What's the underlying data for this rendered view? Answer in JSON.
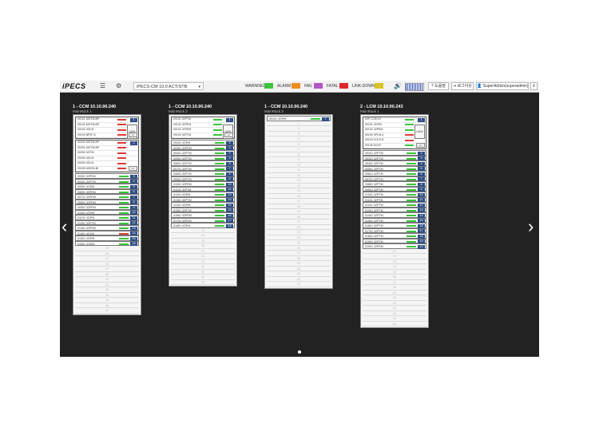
{
  "header": {
    "logo": "iPECS",
    "menu_icon": "hamburger-icon",
    "settings_icon": "gear-icon",
    "system_select": "iPECS-CM 10.0 ACT/STB",
    "legend": [
      {
        "label": "WARNING",
        "color": "#3cc43c"
      },
      {
        "label": "ALARM",
        "color": "#f08c1e"
      },
      {
        "label": "FAIL",
        "color": "#b356c9"
      },
      {
        "label": "FATAL",
        "color": "#e0282a"
      },
      {
        "label": "LINK-DOWN",
        "color": "#d8c227"
      }
    ],
    "sound_icon": "speaker-icon",
    "help_label": "? 도움말",
    "logout_label": "⇥ 로그아웃",
    "user_label": "👤 SuperAdmin(superadmin)",
    "user_caret": "⇕"
  },
  "racks": [
    {
      "title": "1 - CCM 10.10.90.240",
      "subtitle": "MainRack 1",
      "main_groups": [
        {
          "ports": [
            {
              "name": "00101 MGTM-BP",
              "state": "red"
            },
            {
              "name": "00101 MGTM-BP",
              "state": "red"
            },
            {
              "name": "00102 4GLM",
              "state": "red"
            },
            {
              "name": "00103 BP2F-6",
              "state": "red"
            }
          ],
          "badge": "1",
          "tag": "LAN1"
        },
        {
          "ports": [
            {
              "name": "00201 MGTM-BP",
              "state": "red"
            },
            {
              "name": "00201 MGTM-BP",
              "state": "red"
            },
            {
              "name": "00202 4GTM",
              "state": "red"
            },
            {
              "name": "00203 4GLM",
              "state": "red"
            },
            {
              "name": "00204 4GLM",
              "state": "red"
            },
            {
              "name": "00205 MGEM-BI",
              "state": "red"
            }
          ],
          "badge": "2",
          "tag": ""
        }
      ],
      "cards": [
        {
          "name": "00301 32PEM",
          "state": "green",
          "no": "3"
        },
        {
          "name": "00401 32PTM",
          "state": "green",
          "no": "4"
        },
        {
          "name": "00501 4GDM",
          "state": "green",
          "no": "5"
        },
        {
          "name": "00601 32PEM",
          "state": "green",
          "no": "6"
        },
        {
          "name": "00701 32PEM",
          "state": "green",
          "no": "7"
        },
        {
          "name": "00801 32PEM",
          "state": "green",
          "no": "8"
        },
        {
          "name": "00901 32PEM",
          "state": "green",
          "no": "9"
        },
        {
          "name": "01001 VDPM",
          "state": "green",
          "no": "10"
        },
        {
          "name": "01101 VDPM",
          "state": "green",
          "no": "11"
        },
        {
          "name": "01201 32PTM",
          "state": "green",
          "no": "12"
        },
        {
          "name": "01301 32PEM",
          "state": "green",
          "no": "13"
        },
        {
          "name": "01401 4GLM",
          "state": "red",
          "no": "14"
        },
        {
          "name": "01501 VDPM",
          "state": "green",
          "no": "15"
        },
        {
          "name": "01601 4GDM",
          "state": "green",
          "no": "16"
        }
      ],
      "empty_slots": [
        "25",
        "26",
        "27",
        "28",
        "29",
        "30",
        "31",
        "32",
        "33",
        "34",
        "35",
        "36",
        "37"
      ]
    },
    {
      "title": "1 - CCM 10.10.90.240",
      "subtitle": "MainRack 2",
      "main_groups": [
        {
          "ports": [
            {
              "name": "00101 32PTM",
              "state": "green"
            },
            {
              "name": "00102 32PEM",
              "state": "green"
            },
            {
              "name": "00103 32PEM",
              "state": "green"
            },
            {
              "name": "00104 32PTM",
              "state": "green"
            }
          ],
          "badge": "1",
          "tag": "LAN1"
        }
      ],
      "cards": [
        {
          "name": "00201 VDPM",
          "state": "green",
          "no": "2"
        },
        {
          "name": "00301 32PEM",
          "state": "green",
          "no": "3"
        },
        {
          "name": "00401 32PTM",
          "state": "green",
          "no": "4"
        },
        {
          "name": "00501 32PTM",
          "state": "green",
          "no": "5"
        },
        {
          "name": "00601 32PTM",
          "state": "green",
          "no": "6"
        },
        {
          "name": "00701 32PTM",
          "state": "green",
          "no": "7"
        },
        {
          "name": "00801 32PTM",
          "state": "green",
          "no": "8"
        },
        {
          "name": "00901 32PTM",
          "state": "green",
          "no": "9"
        },
        {
          "name": "01001 32PEM",
          "state": "green",
          "no": "10"
        },
        {
          "name": "01101 32PTM",
          "state": "green",
          "no": "11"
        },
        {
          "name": "01201 VDPM",
          "state": "green",
          "no": "12"
        },
        {
          "name": "01301 32PTM",
          "state": "green",
          "no": "13"
        },
        {
          "name": "01401 VDPM",
          "state": "green",
          "no": "14"
        },
        {
          "name": "01501 32PTM",
          "state": "green",
          "no": "15"
        },
        {
          "name": "01601 32PEM",
          "state": "green",
          "no": "16"
        },
        {
          "name": "01701 32PEM",
          "state": "green",
          "no": "17"
        },
        {
          "name": "01801 VDPM",
          "state": "green",
          "no": "18"
        }
      ],
      "empty_slots": [
        "23",
        "24",
        "25",
        "26",
        "27",
        "28",
        "29",
        "30",
        "31",
        "32",
        "33"
      ]
    },
    {
      "title": "1 - CCM 10.10.90.240",
      "subtitle": "MainRack 3",
      "main_groups": [],
      "cards": [
        {
          "name": "00101 VDPM",
          "state": "green",
          "no": "1"
        }
      ],
      "empty_slots": [
        "2",
        "3",
        "4",
        "5",
        "6",
        "7",
        "8",
        "9",
        "10",
        "11",
        "12",
        "13",
        "14",
        "15",
        "16",
        "17",
        "18",
        "19",
        "20",
        "21",
        "22",
        "23",
        "24",
        "25",
        "26",
        "27",
        "28",
        "29",
        "30",
        "31",
        "32",
        "33"
      ]
    },
    {
      "title": "2 - LCM 10.10.90.243",
      "subtitle": "MainRack 1",
      "main_groups": [
        {
          "ports": [
            {
              "name": "00P LCM 5.0",
              "state": "green"
            },
            {
              "name": "00101 VDPM",
              "state": "green"
            },
            {
              "name": "00102 32PEM",
              "state": "green"
            },
            {
              "name": "00103 VPLM-4",
              "state": "red"
            },
            {
              "name": "00104 VOLP-8",
              "state": "red"
            },
            {
              "name": "00105 DOLP",
              "state": "green"
            }
          ],
          "badge": "1",
          "tag": "LAN1"
        }
      ],
      "cards": [
        {
          "name": "00201 32PTM",
          "state": "green",
          "no": "2"
        },
        {
          "name": "00301 32PTM",
          "state": "green",
          "no": "3"
        },
        {
          "name": "00401 32PTM",
          "state": "green",
          "no": "4"
        },
        {
          "name": "00501 32PTM",
          "state": "green",
          "no": "5"
        },
        {
          "name": "00601 32PTM",
          "state": "green",
          "no": "6"
        },
        {
          "name": "00701 32PTM",
          "state": "green",
          "no": "7"
        },
        {
          "name": "00801 32PTM",
          "state": "green",
          "no": "8"
        },
        {
          "name": "00901 32PTM",
          "state": "green",
          "no": "9"
        },
        {
          "name": "01001 32PTM",
          "state": "green",
          "no": "10"
        },
        {
          "name": "01101 32PTM",
          "state": "green",
          "no": "11"
        },
        {
          "name": "01201 32PTM",
          "state": "green",
          "no": "12"
        },
        {
          "name": "01301 32PTM",
          "state": "green",
          "no": "13"
        },
        {
          "name": "01401 32PTM",
          "state": "green",
          "no": "14"
        },
        {
          "name": "01501 32PTM",
          "state": "green",
          "no": "15"
        },
        {
          "name": "01601 32PTM",
          "state": "green",
          "no": "16"
        },
        {
          "name": "01701 32PTM",
          "state": "green",
          "no": "17"
        },
        {
          "name": "01801 32PTM",
          "state": "green",
          "no": "18"
        },
        {
          "name": "01901 32PTM",
          "state": "green",
          "no": "19"
        },
        {
          "name": "02001 32PEM",
          "state": "green",
          "no": "20"
        }
      ],
      "empty_slots": [
        "21",
        "22",
        "23",
        "24",
        "25",
        "26",
        "27",
        "28",
        "29",
        "30",
        "31",
        "32",
        "33",
        "34",
        "35"
      ]
    }
  ],
  "nav": {
    "prev_icon": "chevron-left-icon",
    "next_icon": "chevron-right-icon",
    "prev_glyph": "‹",
    "next_glyph": "›"
  }
}
